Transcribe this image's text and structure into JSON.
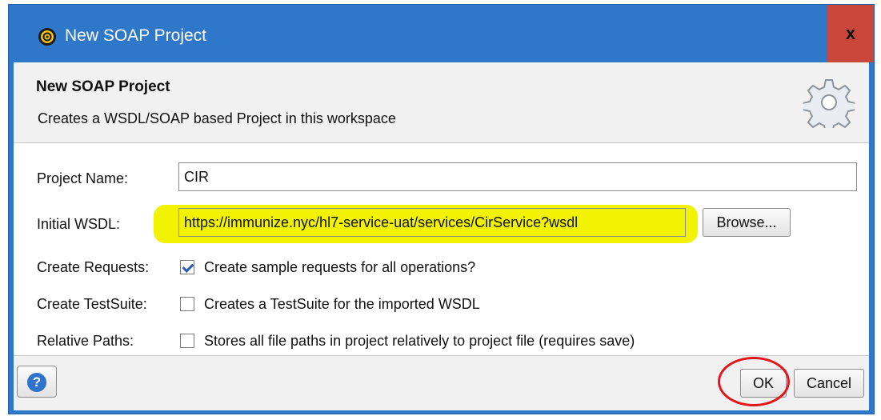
{
  "window": {
    "title": "New SOAP Project",
    "close_label": "x"
  },
  "header": {
    "title": "New SOAP Project",
    "description": "Creates a WSDL/SOAP based Project in this workspace",
    "icon": "gear-icon"
  },
  "form": {
    "project_name_label": "Project Name:",
    "project_name_value": "CIR",
    "initial_wsdl_label": "Initial WSDL:",
    "initial_wsdl_value": "https://immunize.nyc/hl7-service-uat/services/CirService?wsdl",
    "browse_label": "Browse...",
    "create_requests_label": "Create Requests:",
    "create_requests_text": "Create sample requests for all operations?",
    "create_requests_checked": true,
    "create_testsuite_label": "Create TestSuite:",
    "create_testsuite_text": "Creates a TestSuite for the imported WSDL",
    "create_testsuite_checked": false,
    "relative_paths_label": "Relative Paths:",
    "relative_paths_text": "Stores all file paths in project relatively to project file (requires save)",
    "relative_paths_checked": false
  },
  "footer": {
    "help_icon": "help-icon",
    "ok_label": "OK",
    "cancel_label": "Cancel"
  },
  "colors": {
    "titlebar": "#2f77c8",
    "close": "#c8463a",
    "highlight": "#f2f203",
    "annotation": "#e4151c"
  }
}
